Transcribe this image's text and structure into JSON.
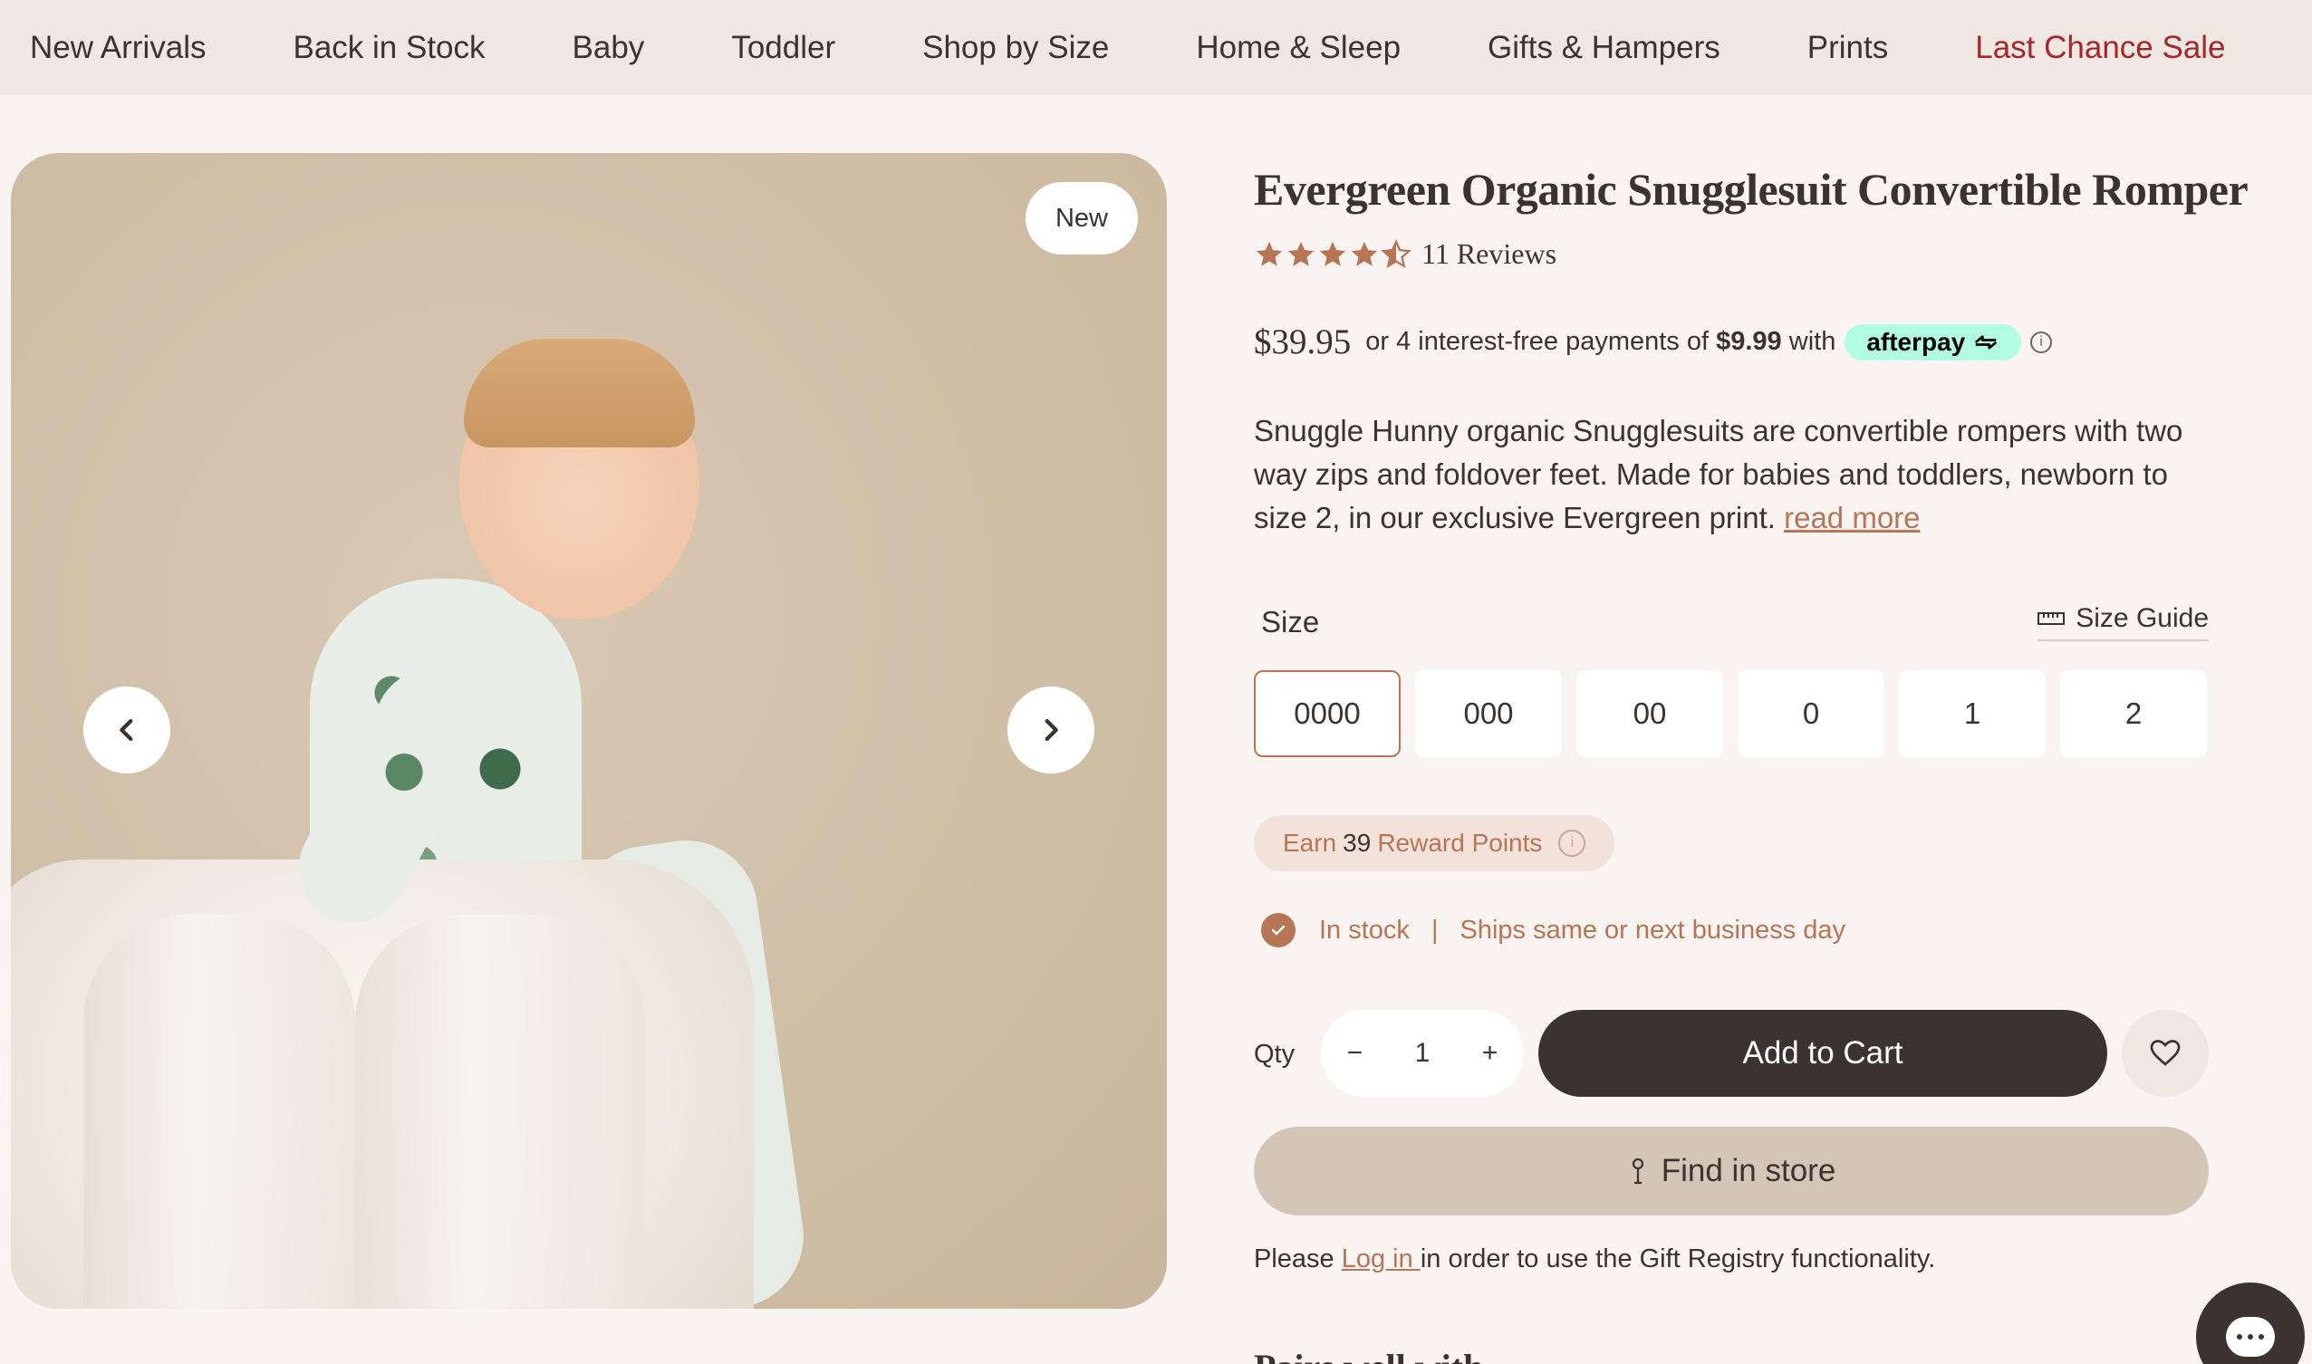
{
  "nav": {
    "items": [
      {
        "label": "New Arrivals"
      },
      {
        "label": "Back in Stock"
      },
      {
        "label": "Baby"
      },
      {
        "label": "Toddler"
      },
      {
        "label": "Shop by Size"
      },
      {
        "label": "Home & Sleep"
      },
      {
        "label": "Gifts & Hampers"
      },
      {
        "label": "Prints"
      },
      {
        "label": "Last Chance Sale",
        "color": "#a8262a"
      }
    ]
  },
  "gallery": {
    "badge": "New",
    "prev_icon": "chevron-left-icon",
    "next_icon": "chevron-right-icon"
  },
  "product": {
    "title": "Evergreen Organic Snugglesuit Convertible Romper",
    "rating": 4.5,
    "reviews": "11 Reviews",
    "price": "$39.95",
    "installments_prefix": "or 4 interest-free payments of",
    "installment_amount": "$9.99",
    "installments_suffix": "with",
    "afterpay_label": "afterpay",
    "description": "Snuggle Hunny organic Snugglesuits are convertible rompers with two way zips and foldover feet. Made for babies and toddlers, newborn to size 2, in our exclusive Evergreen print.",
    "read_more": "read more"
  },
  "size": {
    "label": "Size",
    "guide_label": "Size Guide",
    "options": [
      "0000",
      "000",
      "00",
      "0",
      "1",
      "2"
    ],
    "selected": "0000"
  },
  "rewards": {
    "prefix": "Earn",
    "points": "39",
    "suffix": "Reward Points"
  },
  "stock": {
    "status": "In stock",
    "separator": "|",
    "shipping": "Ships same or next business day"
  },
  "cart": {
    "qty_label": "Qty",
    "qty_value": "1",
    "minus": "−",
    "plus": "+",
    "add_label": "Add to Cart",
    "find_store_label": "Find in store"
  },
  "registry": {
    "prefix": "Please",
    "link": "Log in ",
    "suffix": "in order to use the Gift Registry functionality."
  },
  "pairs_heading": "Pairs well with",
  "colors": {
    "accent": "#b87556",
    "dark": "#3a3330",
    "sale": "#a8262a",
    "afterpay": "#b2fce4"
  }
}
